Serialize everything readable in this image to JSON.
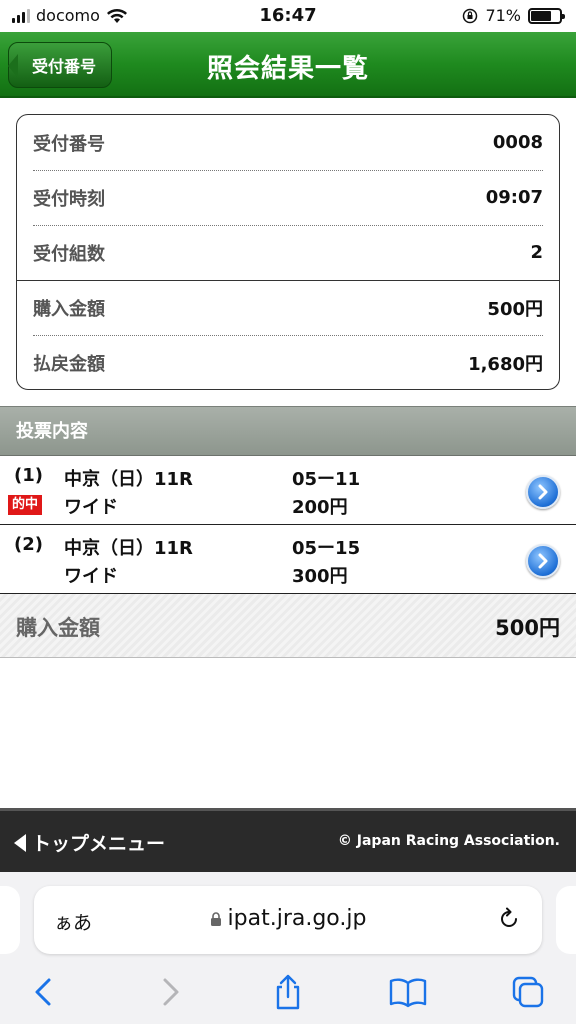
{
  "status_bar": {
    "carrier": "docomo",
    "time": "16:47",
    "battery": "71%",
    "battery_level": 0.71
  },
  "header": {
    "back_label": "受付番号",
    "title": "照会結果一覧"
  },
  "summary": [
    {
      "label": "受付番号",
      "value": "0008"
    },
    {
      "label": "受付時刻",
      "value": "09:07"
    },
    {
      "label": "受付組数",
      "value": "2"
    },
    {
      "label": "購入金額",
      "value": "500円"
    },
    {
      "label": "払戻金額",
      "value": "1,680円"
    }
  ],
  "section": {
    "title": "投票内容"
  },
  "bets": [
    {
      "num": "(1)",
      "race": "中京（日）11R",
      "combo": "05ー11",
      "type": "ワイド",
      "amount": "200円",
      "hit_badge": "的中"
    },
    {
      "num": "(2)",
      "race": "中京（日）11R",
      "combo": "05ー15",
      "type": "ワイド",
      "amount": "300円"
    }
  ],
  "total": {
    "label": "購入金額",
    "value": "500円"
  },
  "footer": {
    "top_menu": "トップメニュー",
    "copyright": "© Japan Racing Association."
  },
  "browser": {
    "aa": "ぁあ",
    "url": "ipat.jra.go.jp"
  },
  "icons": {
    "back": "chevron-left-icon",
    "forward": "chevron-right-icon",
    "share": "share-icon",
    "bookmarks": "book-icon",
    "tabs": "tabs-icon",
    "reload": "reload-icon",
    "lock": "lock-icon",
    "detail": "arrow-circle-icon"
  },
  "colors": {
    "header_green": "#1f8a1f",
    "hit_red": "#e01818",
    "ios_blue": "#1a73e8"
  }
}
